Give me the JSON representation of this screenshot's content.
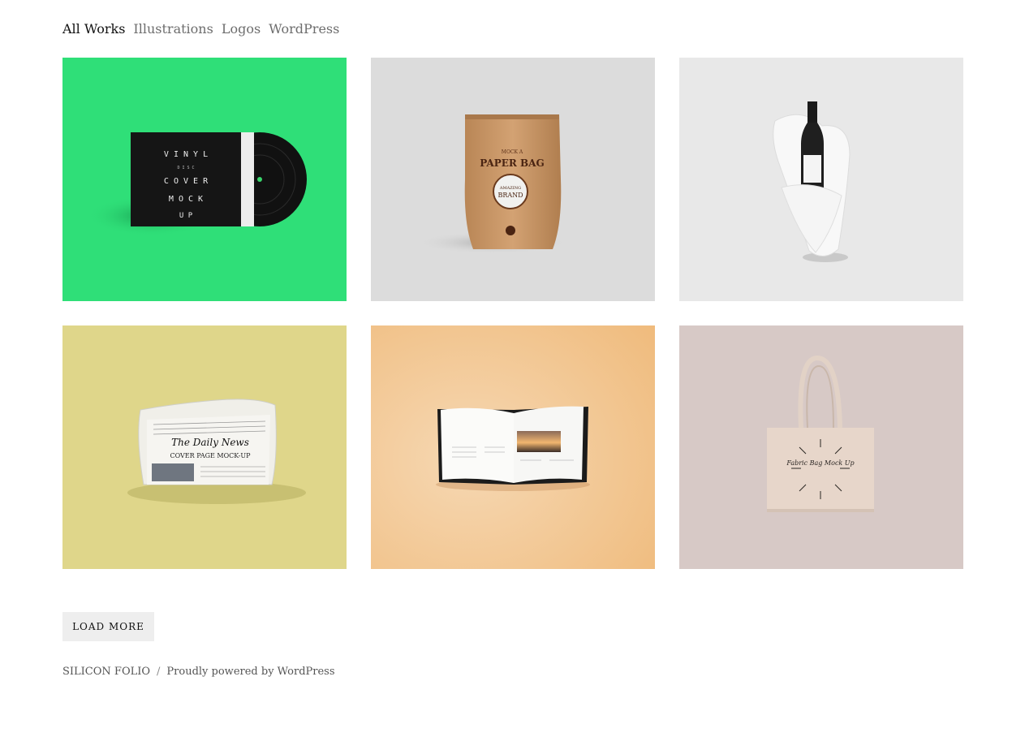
{
  "filters": {
    "items": [
      {
        "label": "All Works",
        "active": true
      },
      {
        "label": "Illustrations",
        "active": false
      },
      {
        "label": "Logos",
        "active": false
      },
      {
        "label": "WordPress",
        "active": false
      }
    ]
  },
  "portfolio": {
    "tiles": [
      {
        "name": "vinyl-mockup",
        "bg": "#2fdf78",
        "letters": [
          "V I N Y L",
          "D I S C",
          "C O V E R",
          "M O C K",
          "U P"
        ]
      },
      {
        "name": "paper-bag-mockup",
        "bg": "#dcdcdc",
        "top_text": "MOCK A",
        "title": "PAPER BAG",
        "badge_line1": "AMAZING",
        "badge_line2": "BRAND"
      },
      {
        "name": "wine-bottle-mockup",
        "bg": "#e8e8e8"
      },
      {
        "name": "newspaper-mockup",
        "bg": "#dfd68a",
        "masthead": "The Daily News",
        "headline": "COVER PAGE MOCK-UP"
      },
      {
        "name": "book-mockup",
        "bg": "#f2c79a"
      },
      {
        "name": "tote-bag-mockup",
        "bg": "#d7c9c6",
        "script_text": "Fabric Bag Mock Up"
      }
    ]
  },
  "actions": {
    "load_more_label": "LOAD MORE"
  },
  "footer": {
    "site_name": "SILICON FOLIO",
    "separator": "/",
    "powered_by": "Proudly powered by WordPress"
  },
  "colors": {
    "text_active": "#111111",
    "text_muted": "#6d6d6d",
    "button_bg": "#eeeeee"
  }
}
